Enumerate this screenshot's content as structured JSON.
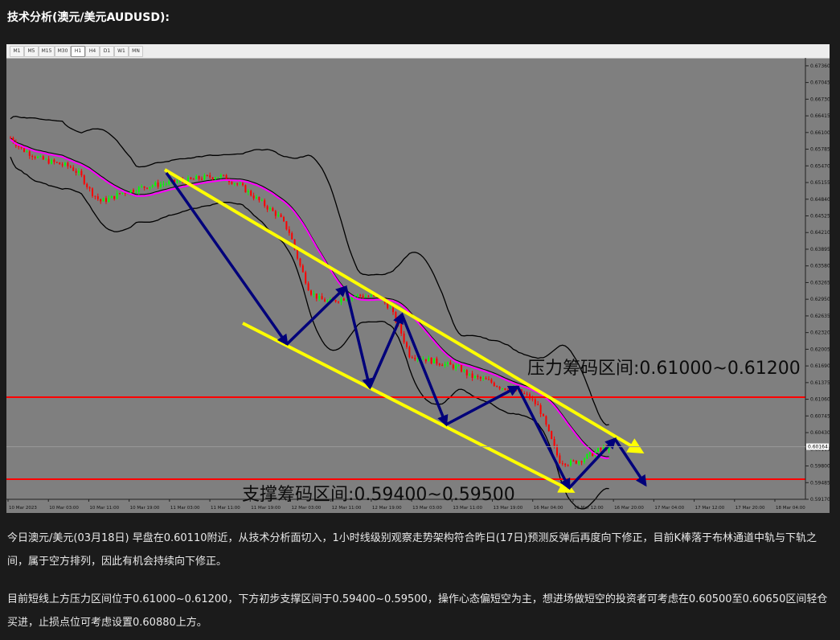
{
  "heading": "技术分析(澳元/美元AUDUSD):",
  "timeframes": [
    {
      "label": "M1",
      "active": false
    },
    {
      "label": "M5",
      "active": false
    },
    {
      "label": "M15",
      "active": false
    },
    {
      "label": "M30",
      "active": false
    },
    {
      "label": "H1",
      "active": true
    },
    {
      "label": "H4",
      "active": false
    },
    {
      "label": "D1",
      "active": false
    },
    {
      "label": "W1",
      "active": false
    },
    {
      "label": "MN",
      "active": false
    }
  ],
  "chart_data": {
    "type": "candlestick",
    "price_axis_labels": [
      "0.67360",
      "0.67045",
      "0.66730",
      "0.66415",
      "0.66100",
      "0.65785",
      "0.65470",
      "0.65155",
      "0.64840",
      "0.64525",
      "0.64210",
      "0.63895",
      "0.63580",
      "0.63265",
      "0.62950",
      "0.62635",
      "0.62320",
      "0.62005",
      "0.61690",
      "0.61375",
      "0.61060",
      "0.60745",
      "0.60430",
      "0.60115",
      "0.59800",
      "0.59485",
      "0.59170"
    ],
    "ylim": [
      0.5917,
      0.6751
    ],
    "time_axis_labels": [
      "10 Mar 2023",
      "10 Mar 03:00",
      "10 Mar 11:00",
      "10 Mar 19:00",
      "11 Mar 03:00",
      "11 Mar 11:00",
      "11 Mar 19:00",
      "12 Mar 03:00",
      "12 Mar 11:00",
      "12 Mar 19:00",
      "13 Mar 03:00",
      "13 Mar 11:00",
      "13 Mar 19:00",
      "16 Mar 04:00",
      "16 Mar 12:00",
      "16 Mar 20:00",
      "17 Mar 04:00",
      "17 Mar 12:00",
      "17 Mar 20:00",
      "18 Mar 04:00"
    ],
    "current_price": "0.60164",
    "resistance_line": 0.611,
    "support_line": 0.5955,
    "resistance_label": "压力筹码区间:0.61000~0.61200",
    "support_label": "支撑筹码区间:0.59400~0.59500",
    "price_path": [
      0.66,
      0.658,
      0.657,
      0.656,
      0.6555,
      0.655,
      0.6545,
      0.653,
      0.65,
      0.648,
      0.6485,
      0.6495,
      0.65,
      0.6505,
      0.651,
      0.6512,
      0.6515,
      0.6518,
      0.652,
      0.6524,
      0.6526,
      0.6528,
      0.652,
      0.651,
      0.6495,
      0.648,
      0.6465,
      0.645,
      0.642,
      0.636,
      0.631,
      0.6295,
      0.629,
      0.6295,
      0.63,
      0.6302,
      0.63,
      0.6298,
      0.628,
      0.624,
      0.619,
      0.6185,
      0.618,
      0.6175,
      0.617,
      0.6165,
      0.615,
      0.6145,
      0.614,
      0.613,
      0.6125,
      0.612,
      0.611,
      0.609,
      0.604,
      0.599,
      0.5985,
      0.599,
      0.6,
      0.601,
      0.6016
    ],
    "colors": {
      "background": "#7f7f7f",
      "bull": "#00ff00",
      "bear": "#ff0000",
      "ma": "#ff00ff",
      "channel": "#ffff00",
      "arrow": "#00007a",
      "level": "#ff0000",
      "bands": "#000000"
    }
  },
  "paragraphs": [
    "今日澳元/美元(03月18日) 早盘在0.60110附近，从技术分析面切入，1小时线级别观察走势架构符合昨日(17日)预测反弹后再度向下修正，目前K棒落于布林通道中轨与下轨之间，属于空方排列，因此有机会持续向下修正。",
    "目前短线上方压力区间位于0.61000~0.61200，下方初步支撑区间于0.59400~0.59500，操作心态偏短空为主，想进场做短空的投资者可考虑在0.60500至0.60650区间轻仓买进，止损点位可考虑设置0.60880上方。"
  ]
}
